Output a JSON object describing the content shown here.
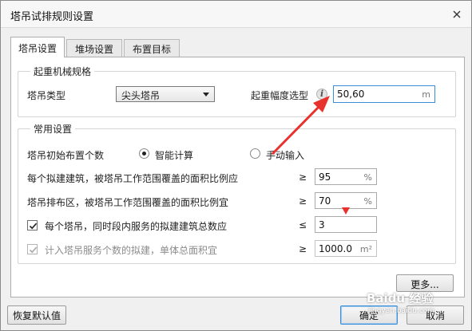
{
  "window": {
    "title": "塔吊试排规则设置"
  },
  "tabs": [
    {
      "label": "塔吊设置",
      "active": true
    },
    {
      "label": "堆场设置",
      "active": false
    },
    {
      "label": "布置目标",
      "active": false
    }
  ],
  "crane_spec": {
    "group_title": "起重机械规格",
    "type_label": "塔吊类型",
    "type_value": "尖头塔吊",
    "radius_label": "起重幅度选型",
    "radius_value": "50,60",
    "radius_unit": "m"
  },
  "common": {
    "group_title": "常用设置",
    "initial_count_label": "塔吊初始布置个数",
    "option_smart": "智能计算",
    "option_manual": "手动输入",
    "selected_option": "智能计算",
    "row_building_ratio": {
      "label": "每个拟建建筑，被塔吊工作范围覆盖的面积比例应",
      "op": "≥",
      "value": "95",
      "unit": "%"
    },
    "row_zone_ratio": {
      "label": "塔吊排布区，被塔吊工作范围覆盖的面积比例宜",
      "op": "≥",
      "value": "70",
      "unit": "%"
    },
    "row_max_buildings": {
      "label": "每个塔吊，同时段内服务的拟建建筑总数应",
      "op": "≤",
      "value": "3",
      "checked": true
    },
    "row_min_area": {
      "label": "计入塔吊服务个数的拟建，单体总面积宜",
      "op": "≥",
      "value": "1000.0",
      "unit": "m²",
      "checked": true,
      "disabled": true
    }
  },
  "buttons": {
    "more": "更多...",
    "restore": "恢复默认值",
    "ok": "确定",
    "cancel": "取消"
  },
  "watermark": {
    "text": "Baidu 经验",
    "sub": "jingyan.baidu.com"
  },
  "colors": {
    "annotation_arrow": "#e8322d",
    "focus_border": "#3b8ed8"
  },
  "icons": {
    "close": "close-icon",
    "info": "info-icon"
  }
}
